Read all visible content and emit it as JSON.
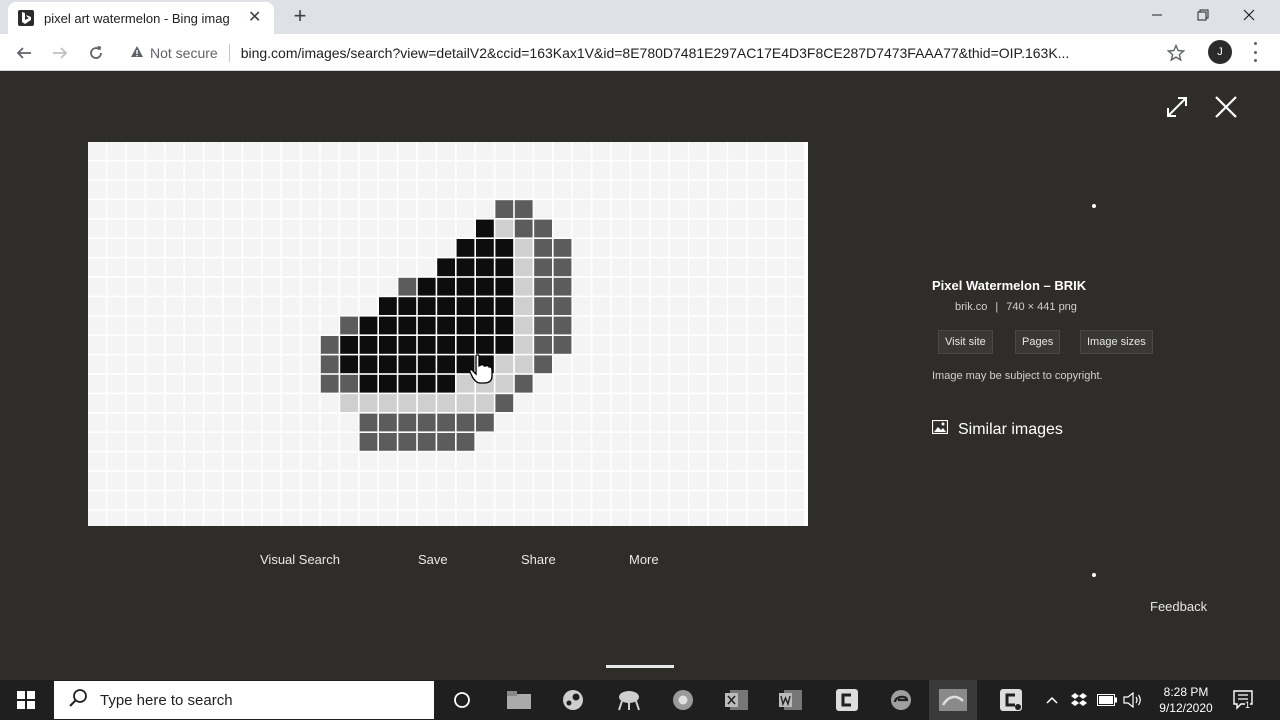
{
  "browser": {
    "tab": {
      "title": "pixel art watermelon - Bing imag",
      "favicon": "bing-icon"
    },
    "controls": {
      "minimize": "minimize-icon",
      "maximize": "restore-icon",
      "close": "close-icon"
    },
    "omnibox": {
      "security": "Not secure",
      "url": "bing.com/images/search?view=detailV2&ccid=163Kax1V&id=8E780D7481E297AC17E4D3F8CE287D7473FAAA77&thid=OIP.163K..."
    },
    "profile_initial": "J"
  },
  "viewer": {
    "actions": [
      "Visual Search",
      "Save",
      "Share",
      "More"
    ],
    "info": {
      "title": "Pixel Watermelon – BRIK",
      "domain": "brik.co",
      "separator": "|",
      "meta": "740 × 441 png",
      "buttons": [
        "Visit site",
        "Pages",
        "Image sizes"
      ],
      "copyright": "Image may be subject to copyright.",
      "similar": "Similar images"
    },
    "feedback": "Feedback"
  },
  "taskbar": {
    "search_placeholder": "Type here to search",
    "clock_time": "8:28 PM",
    "clock_date": "9/12/2020",
    "notification_count": "1"
  }
}
